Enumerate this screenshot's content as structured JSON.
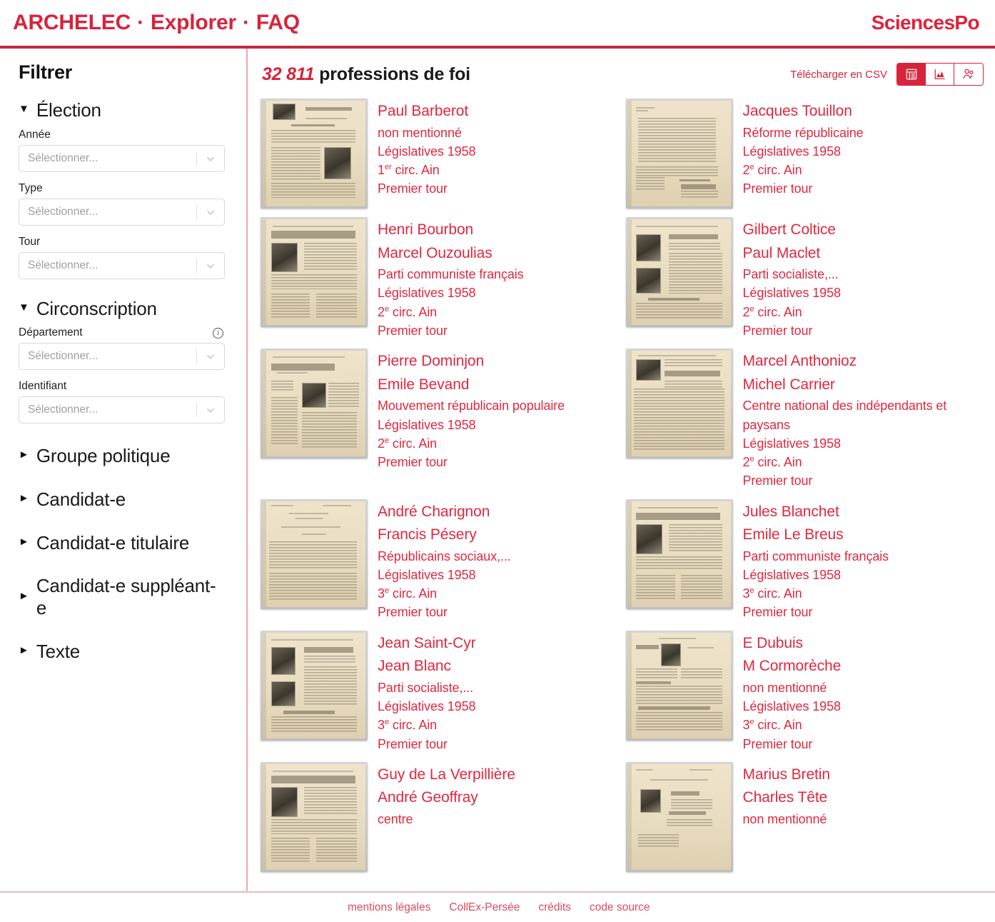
{
  "header": {
    "nav": [
      {
        "label": "ARCHELEC"
      },
      {
        "label": "Explorer"
      },
      {
        "label": "FAQ"
      }
    ],
    "separator": "·",
    "logo": "SciencesPo",
    "accent_color": "#d8233c",
    "rule_color": "#c8273e"
  },
  "sidebar": {
    "title": "Filtrer",
    "groups": [
      {
        "label": "Élection",
        "expanded": true,
        "caret": "▼",
        "fields": [
          {
            "label": "Année",
            "placeholder": "Sélectionner...",
            "value": "",
            "info": false
          },
          {
            "label": "Type",
            "placeholder": "Sélectionner...",
            "value": "",
            "info": false
          },
          {
            "label": "Tour",
            "placeholder": "Sélectionner...",
            "value": "",
            "info": false
          }
        ]
      },
      {
        "label": "Circonscription",
        "expanded": true,
        "caret": "▼",
        "fields": [
          {
            "label": "Département",
            "placeholder": "Sélectionner...",
            "value": "",
            "info": true,
            "info_glyph": "i"
          },
          {
            "label": "Identifiant",
            "placeholder": "Sélectionner...",
            "value": "",
            "info": false
          }
        ]
      },
      {
        "label": "Groupe politique",
        "expanded": false,
        "caret": "►",
        "fields": []
      },
      {
        "label": "Candidat-e",
        "expanded": false,
        "caret": "►",
        "fields": []
      },
      {
        "label": "Candidat-e titulaire",
        "expanded": false,
        "caret": "►",
        "fields": []
      },
      {
        "label": "Candidat-e suppléant-e",
        "expanded": false,
        "caret": "►",
        "fields": []
      },
      {
        "label": "Texte",
        "expanded": false,
        "caret": "►",
        "fields": []
      }
    ]
  },
  "main": {
    "result_count": "32 811",
    "result_label": "professions de foi",
    "download_label": "Télécharger en CSV",
    "view_modes": [
      {
        "name": "list-view",
        "icon": "list-icon",
        "active": true
      },
      {
        "name": "chart-view",
        "icon": "chart-icon",
        "active": false
      },
      {
        "name": "candidates-view",
        "icon": "people-icon",
        "active": false
      }
    ],
    "cards": [
      {
        "names": [
          "Paul Barberot"
        ],
        "party": "non mentionné",
        "election": "Législatives 1958",
        "circ_num": "1",
        "circ_sup": "er",
        "circ_rest": " circ. Ain",
        "tour": "Premier tour",
        "thumb": "portrait-top-left"
      },
      {
        "names": [
          "Jacques Touillon"
        ],
        "party": "Réforme républicaine",
        "election": "Législatives 1958",
        "circ_num": "2",
        "circ_sup": "e",
        "circ_rest": " circ. Ain",
        "tour": "Premier tour",
        "thumb": "text-only-footer-name"
      },
      {
        "names": [
          "Henri Bourbon",
          "Marcel Ouzoulias"
        ],
        "party": "Parti communiste français",
        "election": "Législatives 1958",
        "circ_num": "2",
        "circ_sup": "e",
        "circ_rest": " circ. Ain",
        "tour": "Premier tour",
        "thumb": "headline-portrait-left"
      },
      {
        "names": [
          "Gilbert Coltice",
          "Paul Maclet"
        ],
        "party": "Parti socialiste,...",
        "election": "Législatives 1958",
        "circ_num": "2",
        "circ_sup": "e",
        "circ_rest": " circ. Ain",
        "tour": "Premier tour",
        "thumb": "two-portraits-left"
      },
      {
        "names": [
          "Pierre Dominjon",
          "Emile Bevand"
        ],
        "party": "Mouvement républicain populaire",
        "election": "Législatives 1958",
        "circ_num": "2",
        "circ_sup": "e",
        "circ_rest": " circ. Ain",
        "tour": "Premier tour",
        "thumb": "headline-portrait-center"
      },
      {
        "names": [
          "Marcel Anthonioz",
          "Michel Carrier"
        ],
        "party": "Centre national des indépendants et paysans",
        "election": "Législatives 1958",
        "circ_num": "2",
        "circ_sup": "e",
        "circ_rest": " circ. Ain",
        "tour": "Premier tour",
        "thumb": "portrait-top-left-dense"
      },
      {
        "names": [
          "André Charignon",
          "Francis Pésery"
        ],
        "party": "Républicains sociaux,...",
        "election": "Législatives 1958",
        "circ_num": "3",
        "circ_sup": "e",
        "circ_rest": " circ. Ain",
        "tour": "Premier tour",
        "thumb": "text-only"
      },
      {
        "names": [
          "Jules Blanchet",
          "Emile Le Breus"
        ],
        "party": "Parti communiste français",
        "election": "Législatives 1958",
        "circ_num": "3",
        "circ_sup": "e",
        "circ_rest": " circ. Ain",
        "tour": "Premier tour",
        "thumb": "headline-portrait-left"
      },
      {
        "names": [
          "Jean Saint-Cyr",
          "Jean Blanc"
        ],
        "party": "Parti socialiste,...",
        "election": "Législatives 1958",
        "circ_num": "3",
        "circ_sup": "e",
        "circ_rest": " circ. Ain",
        "tour": "Premier tour",
        "thumb": "two-portraits-left"
      },
      {
        "names": [
          "E Dubuis",
          "M Cormorèche"
        ],
        "party": "non mentionné",
        "election": "Législatives 1958",
        "circ_num": "3",
        "circ_sup": "e",
        "circ_rest": " circ. Ain",
        "tour": "Premier tour",
        "thumb": "portrait-top-center"
      },
      {
        "names": [
          "Guy de La Verpillière",
          "André Geoffray"
        ],
        "party": "centre",
        "election": "",
        "circ_num": "",
        "circ_sup": "",
        "circ_rest": "",
        "tour": "",
        "thumb": "headline-portrait-left"
      },
      {
        "names": [
          "Marius Bretin",
          "Charles Tête"
        ],
        "party": "non mentionné",
        "election": "",
        "circ_num": "",
        "circ_sup": "",
        "circ_rest": "",
        "tour": "",
        "thumb": "portrait-center"
      }
    ]
  },
  "footer": {
    "links": [
      {
        "label": "mentions légales"
      },
      {
        "label": "CollEx-Persée"
      },
      {
        "label": "crédits"
      },
      {
        "label": "code source"
      }
    ]
  }
}
